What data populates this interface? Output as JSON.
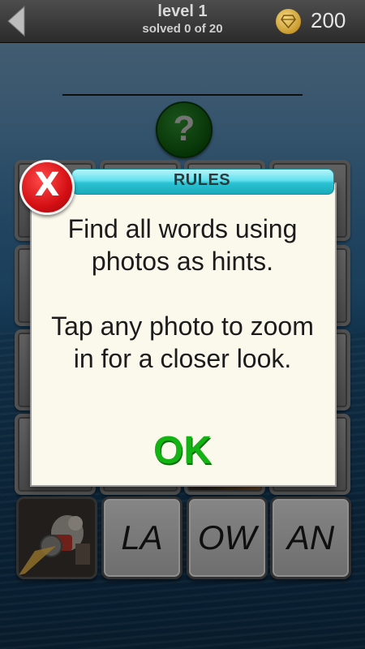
{
  "header": {
    "level_title": "level 1",
    "progress_text": "solved 0 of 20",
    "coins": "200",
    "back_icon": "back-arrow-icon",
    "gem_icon": "diamond-icon"
  },
  "hint_button": {
    "label": "?"
  },
  "letters": [
    "LA",
    "OW",
    "AN"
  ],
  "rules_dialog": {
    "title": "RULES",
    "close_label": "X",
    "line1": "Find all words using photos as hints.",
    "line2": "Tap any photo to zoom in for a closer look.",
    "ok_label": "OK"
  },
  "colors": {
    "accent": "#13b313",
    "close": "#d40f14",
    "header_bar": "#2bc3d4",
    "hint": "#0d5a0d"
  }
}
